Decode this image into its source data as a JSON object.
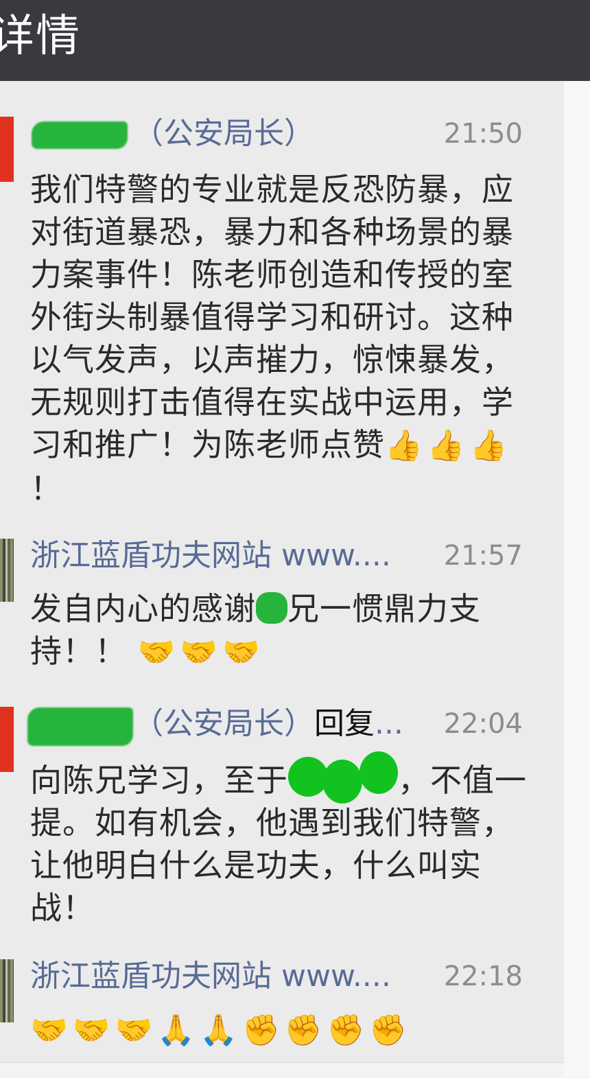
{
  "header": {
    "title": "详情"
  },
  "comments": [
    {
      "name_suffix": "（公安局长）",
      "time": "21:50",
      "text": "我们特警的专业就是反恐防暴，应对街道暴恐，暴力和各种场景的暴力案事件！陈老师创造和传授的室外街头制暴值得学习和研讨。这种以气发声，以声摧力，惊悚暴发，无规则打击值得在实战中运用，学习和推广！为陈老师点赞",
      "emojis": [
        "👍",
        "👍",
        "👍"
      ],
      "tail": "！"
    },
    {
      "name": "浙江蓝盾功夫网站 www....",
      "time": "21:57",
      "text_a": "发自内心的感谢",
      "text_b": "兄一惯鼎力支持！！",
      "emojis": [
        "🤝",
        "🤝",
        "🤝"
      ]
    },
    {
      "name_suffix": "（公安局长）",
      "reply_label": "回复",
      "ellipsis": "...",
      "time": "22:04",
      "text_a": "向陈兄学习，至于",
      "text_b": "，不值一提。如有机会，他遇到我们特警，让他明白什么是功夫，什么叫实战！"
    },
    {
      "name": "浙江蓝盾功夫网站 www....",
      "time": "22:18",
      "emojis": [
        "🤝",
        "🤝",
        "🤝",
        "🙏",
        "🙏",
        "✊",
        "✊",
        "✊",
        "✊"
      ]
    }
  ],
  "colors": {
    "link": "#576b95",
    "header_bg": "#393a3f",
    "redact": "#27b43c"
  }
}
